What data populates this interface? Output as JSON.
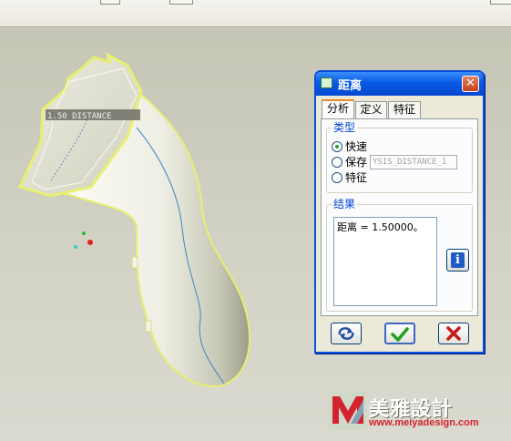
{
  "dialog": {
    "title": "距离",
    "close_label": "✕",
    "tabs": [
      {
        "label": "分析",
        "active": true
      },
      {
        "label": "定义",
        "active": false
      },
      {
        "label": "特征",
        "active": false
      }
    ],
    "type_group": {
      "label": "类型",
      "options": [
        {
          "label": "快速",
          "selected": true
        },
        {
          "label": "保存",
          "selected": false
        },
        {
          "label": "特征",
          "selected": false
        }
      ],
      "feature_name_value": "YSIS_DISTANCE_1"
    },
    "result_group": {
      "label": "结果",
      "text": "距离 = 1.50000。"
    },
    "buttons": {
      "repeat_icon": "repeat-icon",
      "ok_icon": "checkmark-icon",
      "cancel_icon": "cross-icon"
    }
  },
  "viewport": {
    "annotation_label": "1.50 DISTANCE"
  },
  "watermark": {
    "brand": "美雅設計",
    "url": "www.meiyadesign.com"
  },
  "colors": {
    "title_bar": "#0a5be6",
    "group_label": "#0046d5",
    "ok_check": "#21a121",
    "cancel_cross": "#c41a1a",
    "edge_highlight": "#e8ee70",
    "curve": "#3c86c8"
  }
}
